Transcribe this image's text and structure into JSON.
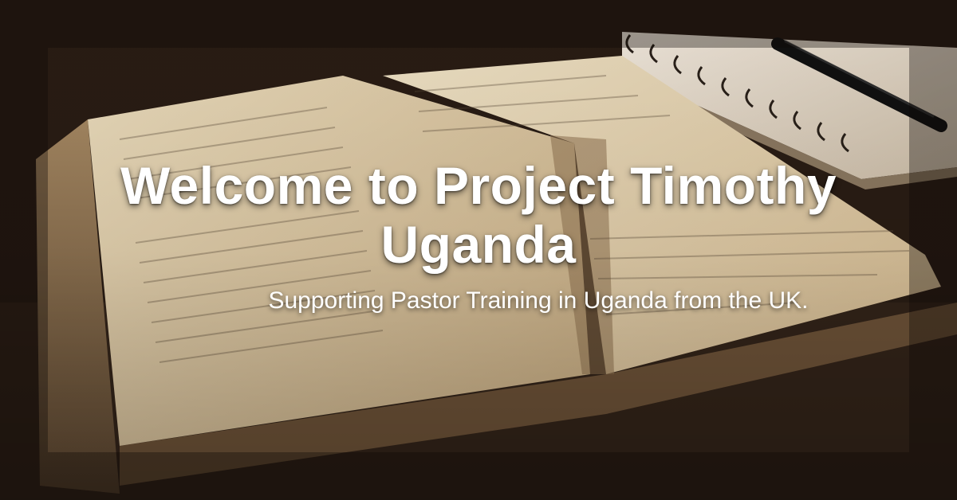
{
  "hero": {
    "title": "Welcome to Project Timothy Uganda",
    "subtitle": "Supporting Pastor Training in Uganda from the UK.",
    "background_icon": "open-bible-photo"
  },
  "colors": {
    "text": "#ffffff",
    "page": "#f1e2c4",
    "wood": "#2e2118"
  }
}
